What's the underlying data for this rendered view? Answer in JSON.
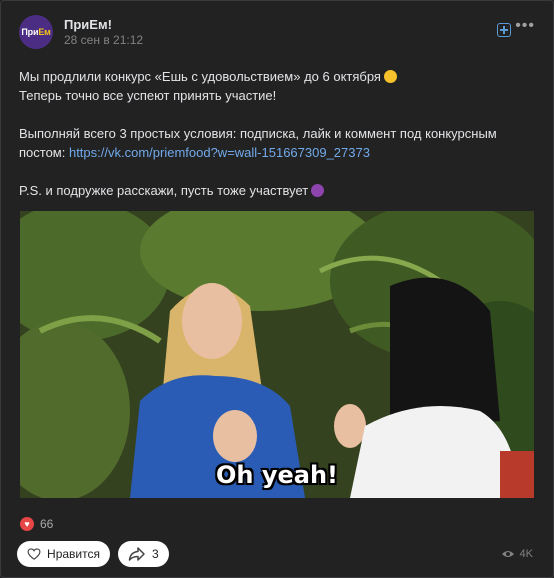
{
  "post": {
    "group_name": "ПриЕм!",
    "avatar_text_a": "При",
    "avatar_text_b": "Ем",
    "date": "28 сен в 21:12",
    "text": {
      "line1": "Мы продлили конкурс «Ешь с удовольствием» до 6 октября",
      "line2": "Теперь точно все успеют принять участие!",
      "line3": "Выполняй всего 3 простых условия: подписка, лайк и коммент под конкурсным",
      "line4_prefix": "постом: ",
      "link": "https://vk.com/priemfood?w=wall-151667309_27373",
      "line5": "P.S. и подружке расскажи, пусть тоже участвует"
    },
    "media_caption": "Oh yeah!",
    "likes_count": "66",
    "like_button_label": "Нравится",
    "share_count": "3",
    "views": "4K"
  },
  "colors": {
    "background": "#222222",
    "link": "#71aaeb",
    "like_badge": "#e64646",
    "accent": "#5b9bd5"
  },
  "icons": [
    "subscribe-plus-icon",
    "more-icon",
    "smile-emoji-icon",
    "devil-emoji-icon",
    "heart-icon",
    "share-arrow-icon",
    "eye-icon"
  ]
}
